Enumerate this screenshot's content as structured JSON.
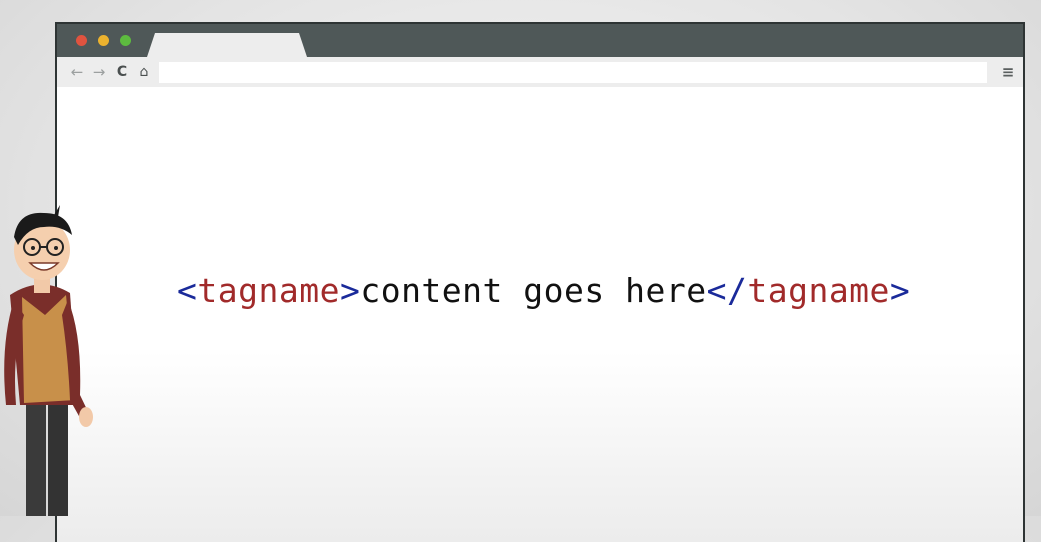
{
  "browser": {
    "address_value": "",
    "colors": {
      "titlebar": "#4f5858",
      "close": "#e0533f",
      "minimize": "#ecb22e",
      "maximize": "#5dbb3f"
    },
    "icons": [
      "back-arrow-icon",
      "forward-arrow-icon",
      "reload-icon",
      "home-icon",
      "menu-icon"
    ]
  },
  "code": {
    "open_bracket": "<",
    "open_tag": "tagname",
    "open_close_bracket": ">",
    "content": "content goes here",
    "close_bracket_slash": "</",
    "close_tag": "tagname",
    "close_close_bracket": ">",
    "colors": {
      "bracket": "#1a2a9a",
      "tag": "#a12a2a",
      "text": "#111111"
    }
  }
}
